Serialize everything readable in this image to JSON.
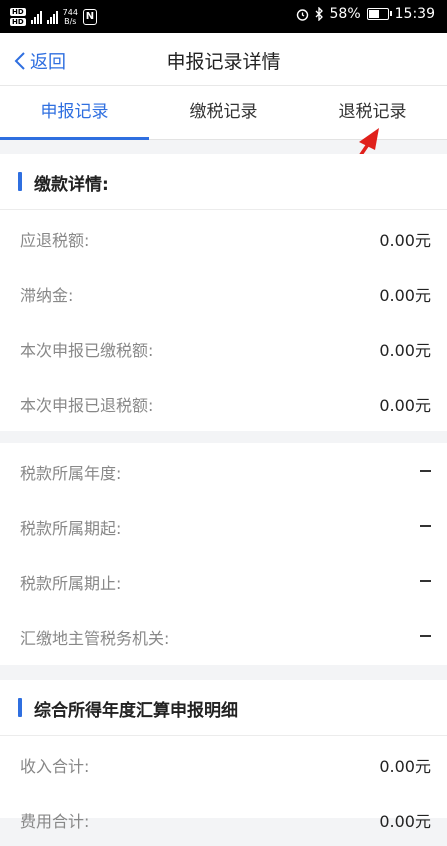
{
  "status": {
    "hd1": "HD",
    "hd2": "HD",
    "net_speed": "744",
    "net_unit": "B/s",
    "nfc": "N",
    "battery_pct": "58%",
    "time": "15:39",
    "battery_level": 0.58
  },
  "nav": {
    "back_label": "返回",
    "title": "申报记录详情"
  },
  "tabs": [
    {
      "label": "申报记录",
      "active": true
    },
    {
      "label": "缴税记录",
      "active": false
    },
    {
      "label": "退税记录",
      "active": false
    }
  ],
  "payment": {
    "title": "缴款详情:",
    "rows": [
      {
        "label": "应退税额:",
        "value": "0.00元"
      },
      {
        "label": "滞纳金:",
        "value": "0.00元"
      },
      {
        "label": "本次申报已缴税额:",
        "value": "0.00元"
      },
      {
        "label": "本次申报已退税额:",
        "value": "0.00元"
      }
    ]
  },
  "tax_period": {
    "rows": [
      {
        "label": "税款所属年度:"
      },
      {
        "label": "税款所属期起:"
      },
      {
        "label": "税款所属期止:"
      },
      {
        "label": "汇缴地主管税务机关:"
      }
    ]
  },
  "annual": {
    "title": "综合所得年度汇算申报明细",
    "rows": [
      {
        "label": "收入合计:",
        "value": "0.00元"
      },
      {
        "label": "费用合计:",
        "value": "0.00元"
      }
    ]
  },
  "colors": {
    "accent": "#2f6fe0",
    "arrow": "#e0201b"
  }
}
